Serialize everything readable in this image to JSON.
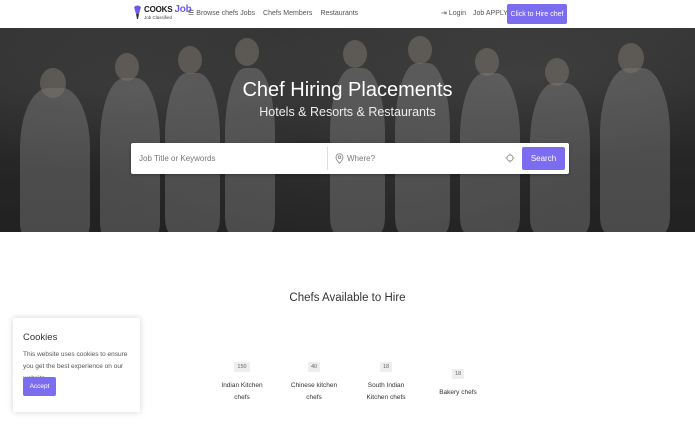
{
  "header": {
    "logo_top": "COOKS",
    "logo_job": "Job",
    "logo_sub": "Job Classified",
    "nav": [
      {
        "label": "Browse chefs Jobs",
        "icon": "menu-icon"
      },
      {
        "label": "Chefs Members"
      },
      {
        "label": "Restaurants"
      }
    ],
    "login_label": "Login",
    "job_apply_label": "Job APPLY",
    "hire_button_label": "Click to Hire chef"
  },
  "hero": {
    "title": "Chef Hiring Placements",
    "subtitle": "Hotels & Resorts & Restaurants"
  },
  "search": {
    "keyword_placeholder": "Job Title or Keywords",
    "location_placeholder": "Where?",
    "button_label": "Search"
  },
  "section": {
    "title": "Chefs Available to Hire",
    "categories": [
      {
        "count": "150",
        "name_line1": "Indian Kitchen",
        "name_line2": "chefs"
      },
      {
        "count": "40",
        "name_line1": "Chinese kitchen",
        "name_line2": "chefs"
      },
      {
        "count": "18",
        "name_line1": "South Indian",
        "name_line2": "Kitchen chefs"
      },
      {
        "count": "18",
        "name_line1": "Bakery chefs",
        "name_line2": ""
      }
    ]
  },
  "cookie": {
    "title": "Cookies",
    "text": "This website uses cookies to ensure you get the best experience on our website.",
    "accept_label": "Accept"
  },
  "colors": {
    "accent": "#7c6cf0"
  }
}
